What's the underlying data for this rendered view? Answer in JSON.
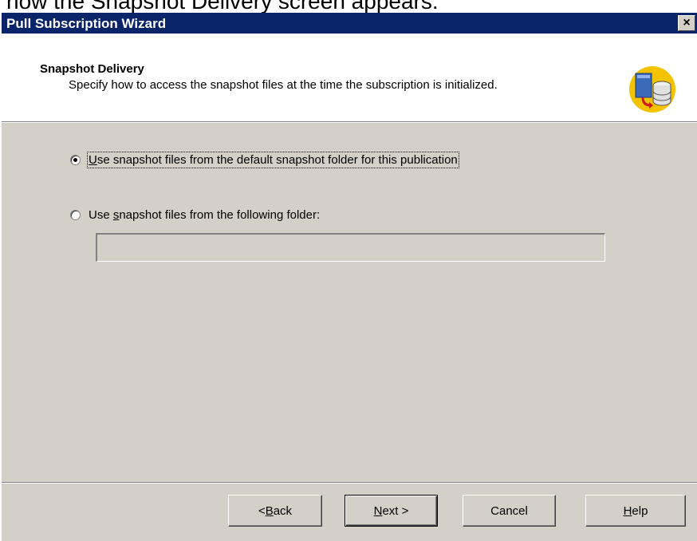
{
  "top_strip": {
    "text": "how the Snapshot Delivery screen appears:"
  },
  "window": {
    "title": "Pull Subscription Wizard",
    "close_label": "×"
  },
  "header": {
    "title": "Snapshot Delivery",
    "subtitle": "Specify how to access the snapshot files at the time the subscription is initialized.",
    "icon": "snapshot-database-icon"
  },
  "options": {
    "default_folder": {
      "access_key": "U",
      "label_rest": "se snapshot files from the default snapshot folder for this publication",
      "selected": true
    },
    "following_folder": {
      "label_pre": "Use ",
      "access_key": "s",
      "label_rest": "napshot files from the following folder:",
      "selected": false
    }
  },
  "folder_input": {
    "value": ""
  },
  "buttons": {
    "back": {
      "pre": "< ",
      "access_key": "B",
      "rest": "ack"
    },
    "next": {
      "access_key": "N",
      "rest": "ext >"
    },
    "cancel": {
      "label": "Cancel"
    },
    "help": {
      "access_key": "H",
      "rest": "elp"
    }
  },
  "colors": {
    "titlebar": "#0a246a",
    "dialog_face": "#d4d0c8",
    "icon_circle": "#f3c300"
  }
}
